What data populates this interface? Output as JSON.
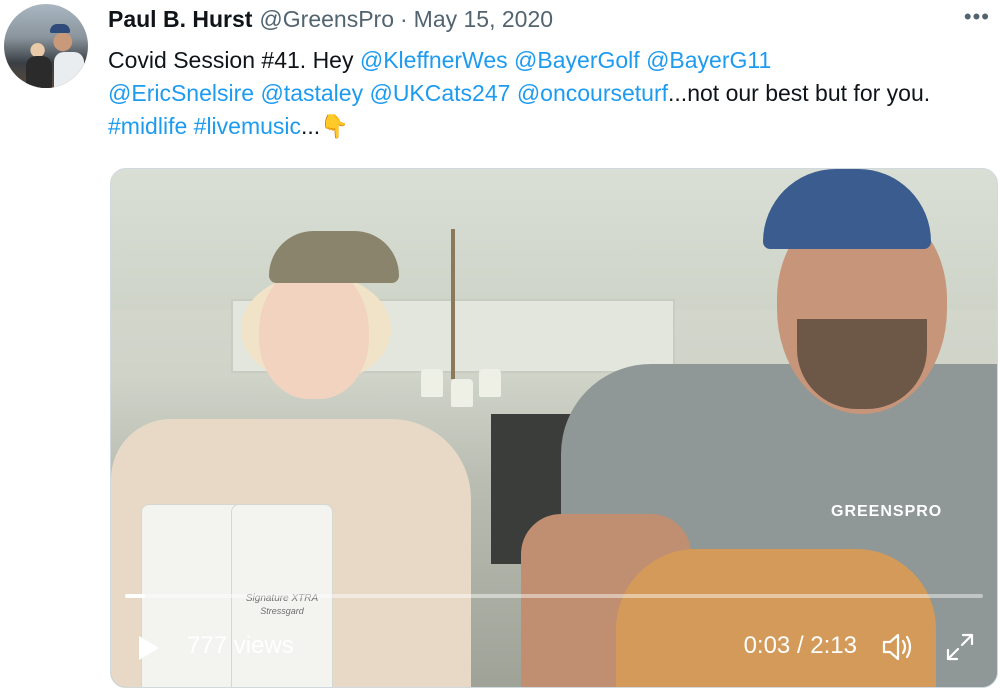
{
  "author": {
    "name": "Paul B. Hurst",
    "handle": "@GreensPro",
    "separator": "·",
    "date": "May 15, 2020"
  },
  "more_icon": "more-horizontal-icon",
  "tweet": {
    "t1": "Covid Session #41. Hey ",
    "m1": "@KleffnerWes",
    "m2": "@BayerGolf",
    "m3": "@BayerG11",
    "m4": "@EricSnelsire",
    "m5": "@tastaley",
    "m6": "@UKCats247",
    "m7": "@oncourseturf",
    "t2": "...not our best but for you. ",
    "h1": "#midlife",
    "h2": "#livemusic",
    "t3": "...",
    "emoji": "👇"
  },
  "video": {
    "views": "777 views",
    "time": "0:03 / 2:13",
    "progress": 0.023,
    "shirt_logo": "GREENSPRO",
    "can_text_1": "Signature XTRA",
    "can_text_2": "Stressgard"
  },
  "colors": {
    "link": "#1d9bf0",
    "text": "#0f1419",
    "secondary": "#536471"
  }
}
